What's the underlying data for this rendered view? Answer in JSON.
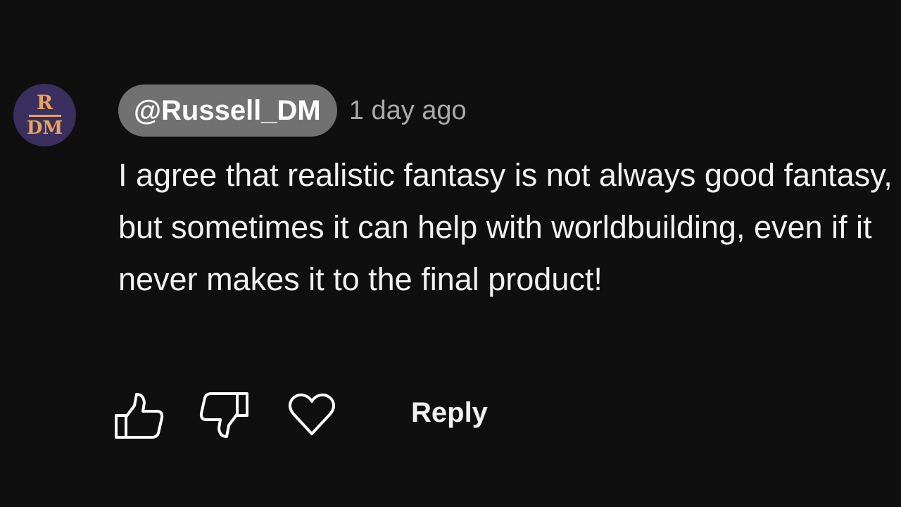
{
  "comment": {
    "avatar": {
      "monogram_top": "R",
      "monogram_bottom": "DM",
      "background_color": "#3a2f5e",
      "accent_color": "#e8a35a"
    },
    "author_handle": "@Russell_DM",
    "timestamp": "1 day ago",
    "text": "I agree that realistic fantasy is not always good fantasy, but sometimes it can help with worldbuilding, even if it never makes it to the final product!",
    "actions": {
      "like_icon": "thumbs-up-icon",
      "dislike_icon": "thumbs-down-icon",
      "heart_icon": "heart-icon",
      "reply_label": "Reply"
    }
  }
}
